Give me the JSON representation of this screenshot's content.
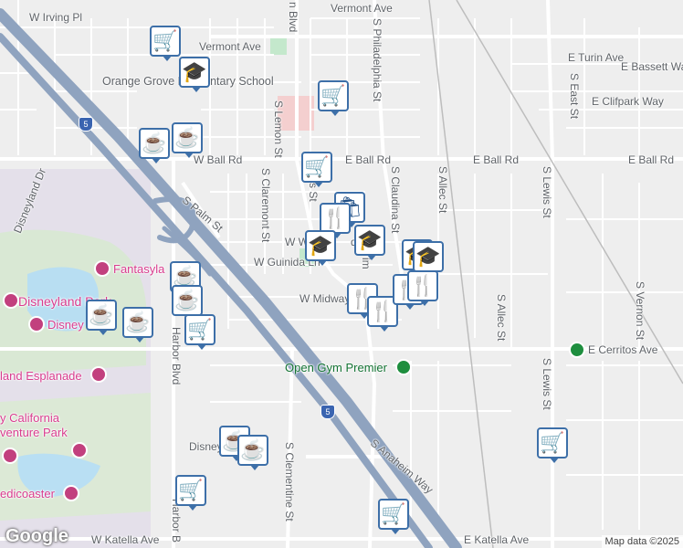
{
  "streets": {
    "w_irving_pl": "W Irving Pl",
    "vermont_ave_w": "Vermont Ave",
    "vermont_ave_e": "Vermont Ave",
    "e_turin_ave": "E Turin Ave",
    "e_bassett_way": "E Bassett Way",
    "e_clifpark_way": "E Clifpark Way",
    "w_ball_rd": "W Ball Rd",
    "e_ball_rd_1": "E Ball Rd",
    "e_ball_rd_2": "E Ball Rd",
    "e_ball_rd_3": "E Ball Rd",
    "s_lemon_st": "S Lemon St",
    "s_philadelphia_st": "S Philadelphia St",
    "s_claudina_st": "S Claudina St",
    "s_allec_st_top": "S Allec St",
    "s_allec_st_mid": "S Allec St",
    "s_lewis_st_top": "S Lewis St",
    "s_lewis_st_bot": "S Lewis St",
    "s_east_st": "S East St",
    "s_vernon_st": "S Vernon St",
    "s_claremont_st": "S Claremont St",
    "s_palm_st": "S Palm St",
    "disneyland_dr": "Disneyland Dr",
    "w_guinida_ln": "W Guinida Ln",
    "w_midway": "W Midway",
    "w_w_frag": "W W",
    "harbor_blvd": "Harbor Blvd",
    "harbor_b_bottom": "Harbor B",
    "n_blvd_frag": "n Blvd",
    "e_cerritos_ave": "E Cerritos Ave",
    "s_clementine_st": "S Clementine St",
    "s_anaheim_way": "S Anaheim Way",
    "w_katella_ave": "W Katella Ave",
    "e_katella_ave": "E Katella Ave",
    "disney_frag": "Disney",
    "ls_st_frag": "s St",
    "d_frag": "d",
    "im_frag": "im",
    "d_st_frag": "d St"
  },
  "places": {
    "school": "Orange Grove Elementary School",
    "fantasyland": "Fantasyla",
    "disneyland_park": "Disneyland Park",
    "disney_frag": "Disney",
    "esplanade": "land Esplanade",
    "california_1": "y California",
    "california_2": "venture Park",
    "coaster": "edicoaster",
    "open_gym": "Open Gym Premier"
  },
  "freeway_shields": [
    "5",
    "5"
  ],
  "markers": [
    {
      "icon": "shopping-cart-icon",
      "glyph": "🛒"
    },
    {
      "icon": "school-icon",
      "glyph": "🎓"
    },
    {
      "icon": "shopping-cart-icon",
      "glyph": "🛒"
    },
    {
      "icon": "coffee-icon",
      "glyph": "☕"
    },
    {
      "icon": "coffee-icon",
      "glyph": "☕"
    },
    {
      "icon": "shopping-cart-icon",
      "glyph": "🛒"
    },
    {
      "icon": "shopping-bag-icon",
      "glyph": "🛍"
    },
    {
      "icon": "restaurant-icon",
      "glyph": "🍴"
    },
    {
      "icon": "school-icon",
      "glyph": "🎓"
    },
    {
      "icon": "school-icon",
      "glyph": "🎓"
    },
    {
      "icon": "school-icon",
      "glyph": "🎓"
    },
    {
      "icon": "school-icon",
      "glyph": "🎓"
    },
    {
      "icon": "restaurant-icon",
      "glyph": "🍴"
    },
    {
      "icon": "restaurant-icon",
      "glyph": "🍴"
    },
    {
      "icon": "restaurant-icon",
      "glyph": "🍴"
    },
    {
      "icon": "restaurant-icon",
      "glyph": "🍴"
    },
    {
      "icon": "coffee-icon",
      "glyph": "☕"
    },
    {
      "icon": "coffee-icon",
      "glyph": "☕"
    },
    {
      "icon": "shopping-cart-icon",
      "glyph": "🛒"
    },
    {
      "icon": "coffee-icon",
      "glyph": "☕"
    },
    {
      "icon": "coffee-icon",
      "glyph": "☕"
    },
    {
      "icon": "coffee-icon",
      "glyph": "☕"
    },
    {
      "icon": "coffee-icon",
      "glyph": "☕"
    },
    {
      "icon": "shopping-cart-icon",
      "glyph": "🛒"
    },
    {
      "icon": "shopping-cart-icon",
      "glyph": "🛒"
    },
    {
      "icon": "shopping-cart-icon",
      "glyph": "🛒"
    }
  ],
  "google_logo": "Google",
  "attribution": "Map data ©2025",
  "colors": {
    "marker_border": "#3d6fa8",
    "freeway": "#8fa3bf",
    "park": "#a8dab5",
    "theme_park": "#e8dff0"
  }
}
